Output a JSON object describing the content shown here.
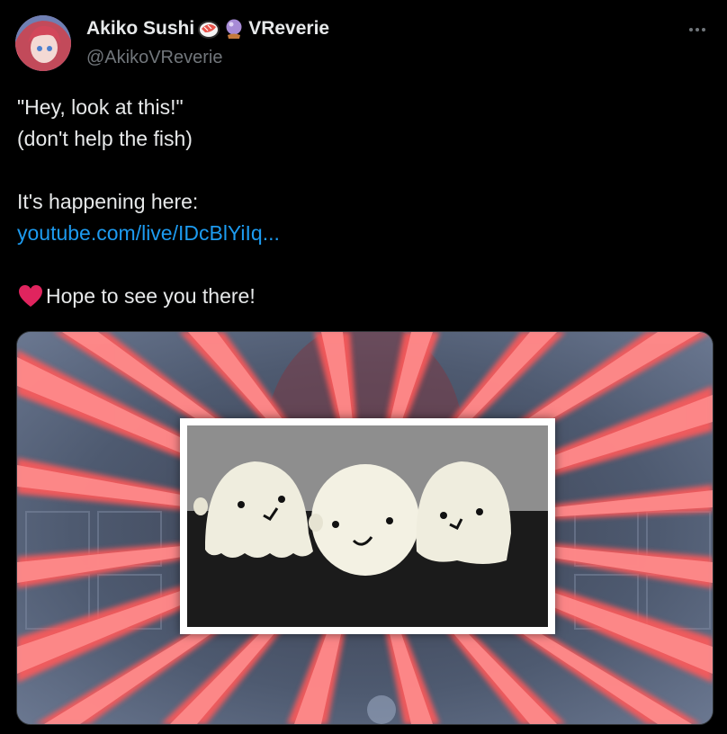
{
  "author": {
    "display_name": "Akiko Sushi",
    "display_name_suffix": "VReverie",
    "handle": "@AkikoVReverie",
    "emojis": [
      "sushi-emoji",
      "crystal-ball-emoji"
    ]
  },
  "tweet": {
    "lines": [
      "\"Hey, look at this!\"",
      "(don't help the fish)",
      "",
      "It's happening here:",
      "youtube.com/live/IDcBlYiIq...",
      "",
      "Hope to see you there!"
    ],
    "link": "youtube.com/live/IDcBlYiIq...",
    "heart_icon": "red-heart-emoji"
  },
  "media": {
    "type": "image",
    "subject": "three crocheted ghost plushies"
  },
  "colors": {
    "background": "#000000",
    "text": "#e7e9ea",
    "muted": "#71767b",
    "link": "#1d9bf0",
    "heart": "#e0245e"
  }
}
